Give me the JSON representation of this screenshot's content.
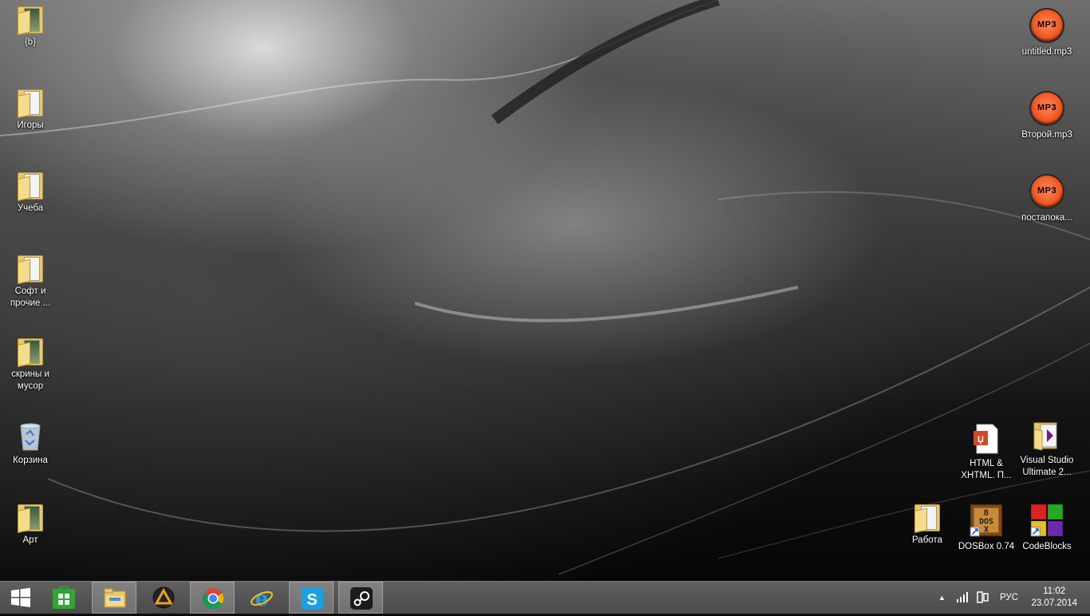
{
  "desktop": {
    "left_icons": [
      {
        "label": "{b}",
        "type": "folder"
      },
      {
        "label": "Игоры",
        "type": "folder"
      },
      {
        "label": "Учеба",
        "type": "folder"
      },
      {
        "label": "Софт и прочие ...",
        "type": "folder"
      },
      {
        "label": "скрины и мусор",
        "type": "folder"
      },
      {
        "label": "Корзина",
        "type": "recycle-bin"
      },
      {
        "label": "Арт",
        "type": "folder"
      }
    ],
    "right_icons": [
      {
        "label": "untitled.mp3",
        "type": "mp3"
      },
      {
        "label": "Второй.mp3",
        "type": "mp3"
      },
      {
        "label": "постапока...",
        "type": "mp3"
      }
    ],
    "mp3_badge": "MP3",
    "bottom_right_icons": [
      {
        "label": "HTML & XHTML. П...",
        "type": "pdf"
      },
      {
        "label": "Visual Studio Ultimate 2...",
        "type": "folder"
      },
      {
        "label": "Работа",
        "type": "folder"
      },
      {
        "label": "DOSBox 0.74",
        "type": "dosbox"
      },
      {
        "label": "CodeBlocks",
        "type": "codeblocks"
      }
    ]
  },
  "taskbar": {
    "buttons": [
      {
        "name": "start",
        "icon": "windows-logo-icon"
      },
      {
        "name": "store",
        "icon": "store-icon"
      },
      {
        "name": "file-explorer",
        "icon": "file-explorer-icon"
      },
      {
        "name": "aimp",
        "icon": "aimp-icon"
      },
      {
        "name": "chrome",
        "icon": "chrome-icon"
      },
      {
        "name": "internet-explorer",
        "icon": "internet-explorer-icon"
      },
      {
        "name": "skype",
        "icon": "skype-icon"
      },
      {
        "name": "steam",
        "icon": "steam-icon"
      }
    ],
    "tray": {
      "language": "РУС",
      "time": "11:02",
      "date": "23.07.2014"
    }
  },
  "colors": {
    "taskbar": "#555555",
    "folder": "#e9c96b",
    "mp3_orange": "#f0541e",
    "store_green": "#2fa82f",
    "skype_blue": "#1ba1e2"
  }
}
